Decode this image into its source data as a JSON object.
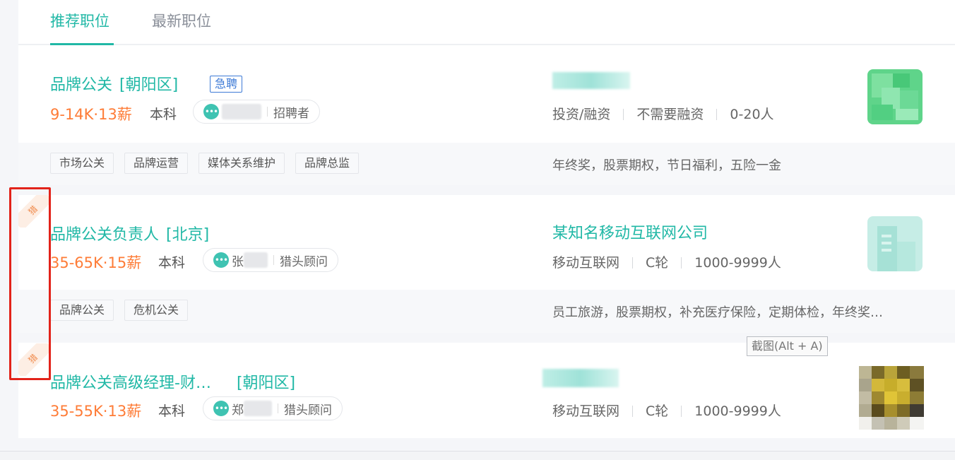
{
  "tabs": [
    {
      "label": "推荐职位",
      "active": true
    },
    {
      "label": "最新职位",
      "active": false
    }
  ],
  "jobs": [
    {
      "title": "品牌公关",
      "area": "[朝阳区]",
      "urgent": "急聘",
      "salary": "9-14K·13薪",
      "degree": "本科",
      "recruiter_role": "招聘者",
      "company_info": [
        "投资/融资",
        "不需要融资",
        "0-20人"
      ],
      "tags": [
        "市场公关",
        "品牌运营",
        "媒体关系维护",
        "品牌总监"
      ],
      "benefits": "年终奖，股票期权，节日福利，五险一金",
      "recommended": false
    },
    {
      "title": "品牌公关负责人",
      "area": "[北京]",
      "salary": "35-65K·15薪",
      "degree": "本科",
      "recruiter_name": "张",
      "recruiter_role": "猎头顾问",
      "company": "某知名移动互联网公司",
      "company_info": [
        "移动互联网",
        "C轮",
        "1000-9999人"
      ],
      "tags": [
        "品牌公关",
        "危机公关"
      ],
      "benefits": "员工旅游，股票期权，补充医疗保险，定期体检，年终奖…",
      "recommended": true,
      "badge": "猎"
    },
    {
      "title": "品牌公关高级经理-财…",
      "area": "[朝阳区]",
      "salary": "35-55K·13薪",
      "degree": "本科",
      "recruiter_name": "郑",
      "recruiter_role": "猎头顾问",
      "company_info": [
        "移动互联网",
        "C轮",
        "1000-9999人"
      ],
      "recommended": true,
      "badge": "猎"
    }
  ],
  "tooltip": "截图(Alt + A)",
  "colors": {
    "accent": "#21b8a6",
    "salary": "#fe7c37",
    "highlight": "#e2231a"
  }
}
